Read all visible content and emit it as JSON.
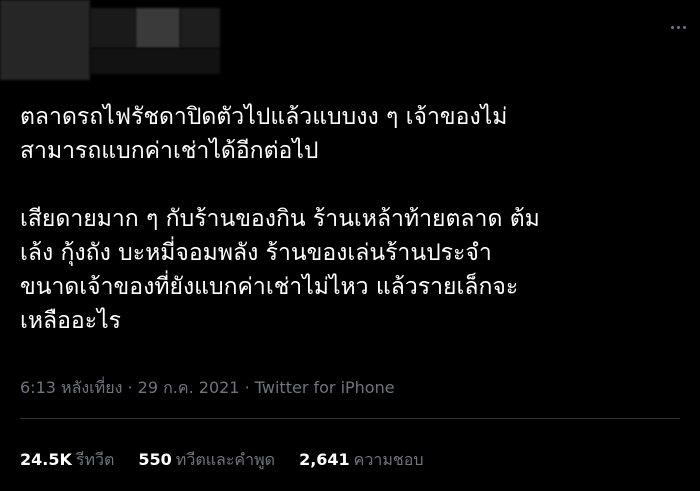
{
  "tweet": {
    "paragraphs": [
      "ตลาดรถไฟรัชดาปิดตัวไปแล้วแบบงง ๆ เจ้าของไม่\nสามารถแบกค่าเช่าได้อีกต่อไป",
      "เสียดายมาก ๆ กับร้านของกิน ร้านเหล้าท้ายตลาด ต้ม\nเล้ง กุ้งถัง บะหมี่จอมพลัง ร้านของเล่นร้านประจำ\nขนาดเจ้าของที่ยังแบกค่าเช่าไม่ไหว แล้วรายเล็กจะ\nเหลืออะไร"
    ]
  },
  "meta": {
    "time": "6:13 หลังเที่ยง",
    "dot": "·",
    "date": "29 ก.ค. 2021",
    "source": "Twitter for iPhone"
  },
  "stats": {
    "retweets_count": "24.5K",
    "retweets_label": "รีทวีต",
    "quotes_count": "550",
    "quotes_label": "ทวีตและคำพูด",
    "likes_count": "2,641",
    "likes_label": "ความชอบ"
  },
  "colors": {
    "background": "#000000",
    "text": "#ffffff",
    "secondary": "#6e767d"
  },
  "icons": [
    "more-icon"
  ]
}
